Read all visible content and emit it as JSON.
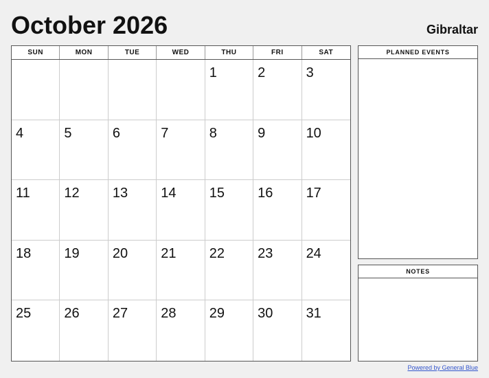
{
  "header": {
    "title": "October 2026",
    "region": "Gibraltar"
  },
  "calendar": {
    "day_headers": [
      "SUN",
      "MON",
      "TUE",
      "WED",
      "THU",
      "FRI",
      "SAT"
    ],
    "weeks": [
      [
        null,
        null,
        null,
        null,
        1,
        2,
        3
      ],
      [
        4,
        5,
        6,
        7,
        8,
        9,
        10
      ],
      [
        11,
        12,
        13,
        14,
        15,
        16,
        17
      ],
      [
        18,
        19,
        20,
        21,
        22,
        23,
        24
      ],
      [
        25,
        26,
        27,
        28,
        29,
        30,
        31
      ]
    ]
  },
  "sidebar": {
    "planned_events_label": "PLANNED EVENTS",
    "notes_label": "NOTES"
  },
  "footer": {
    "link_text": "Powered by General Blue"
  }
}
